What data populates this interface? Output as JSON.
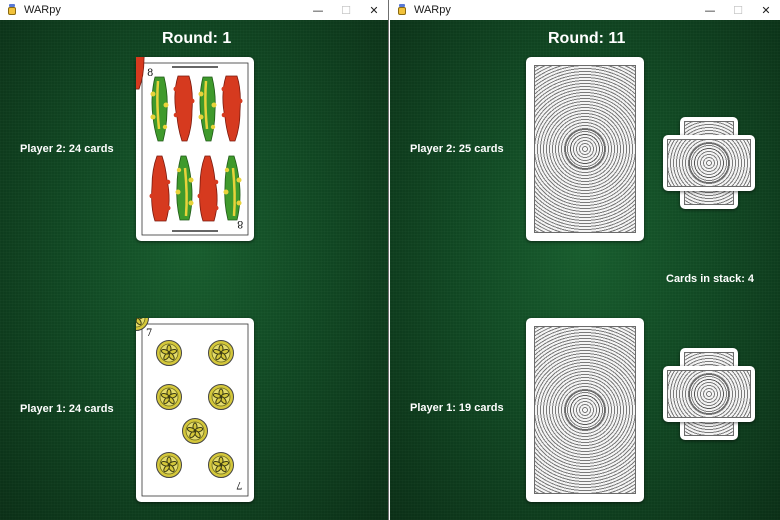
{
  "windows": [
    {
      "title": "WARpy",
      "controls": {
        "minimize": "—",
        "maximize": "☐",
        "close": "✕"
      },
      "round_label": "Round: 1",
      "player2_label": "Player 2: 24 cards",
      "player1_label": "Player 1: 24 cards",
      "player2_card": {
        "rank": "8",
        "suit": "bastos",
        "face_up": true
      },
      "player1_card": {
        "rank": "7",
        "suit": "oros",
        "face_up": true
      }
    },
    {
      "title": "WARpy",
      "controls": {
        "minimize": "—",
        "maximize": "☐",
        "close": "✕"
      },
      "round_label": "Round: 11",
      "player2_label": "Player 2: 25 cards",
      "player1_label": "Player 1: 19 cards",
      "stack_label": "Cards in stack: 4",
      "player2_card": {
        "face_up": false
      },
      "player1_card": {
        "face_up": false
      }
    }
  ],
  "icons": {
    "app": "python-jar-icon"
  },
  "colors": {
    "felt": "#124c25",
    "titlebar": "#ffffff",
    "text": "#ffffff",
    "bastos_green": "#3f9a2c",
    "bastos_red": "#d63a1f",
    "oros_gold": "#d4c73a"
  }
}
